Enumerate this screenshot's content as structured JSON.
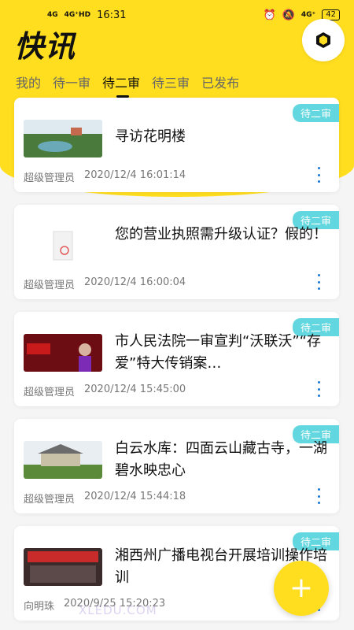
{
  "status_bar": {
    "left_tags": [
      "4G",
      "4G⁺HD"
    ],
    "time": "16:31",
    "right_tag": "4G⁺",
    "battery": "42"
  },
  "header": {
    "title": "快讯"
  },
  "tabs": [
    {
      "label": "我的"
    },
    {
      "label": "待一审"
    },
    {
      "label": "待二审"
    },
    {
      "label": "待三审"
    },
    {
      "label": "已发布"
    }
  ],
  "cards": [
    {
      "badge": "待二审",
      "title": "寻访花明楼",
      "author": "超级管理员",
      "time": "2020/12/4 16:01:14"
    },
    {
      "badge": "待二审",
      "title": "您的营业执照需升级认证？假的！",
      "author": "超级管理员",
      "time": "2020/12/4 16:00:04"
    },
    {
      "badge": "待二审",
      "title": "市人民法院一审宣判“沃联沃”“存爱”特大传销案…",
      "author": "超级管理员",
      "time": "2020/12/4 15:45:00"
    },
    {
      "badge": "待二审",
      "title": "白云水库：四面云山藏古寺，一湖碧水映忠心",
      "author": "超级管理员",
      "time": "2020/12/4 15:44:18"
    },
    {
      "badge": "待二审",
      "title": "湘西州广播电视台开展培训操作培训",
      "author": "向明珠",
      "time": "2020/9/25 15:20:23"
    }
  ],
  "fab": {
    "label": "+"
  },
  "watermark": "XLEDU.COM",
  "colors": {
    "accent": "#ffdd1f",
    "badge": "#63d7e0",
    "more": "#1976d2"
  }
}
